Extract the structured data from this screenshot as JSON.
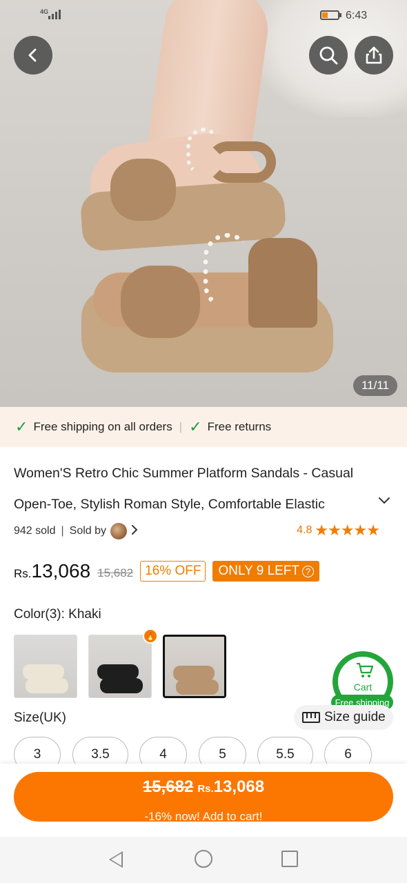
{
  "status_bar": {
    "network": "4G",
    "time": "6:43"
  },
  "hero": {
    "image_counter": "11/11"
  },
  "icons": {
    "back": "chevron-left-icon",
    "search": "search-icon",
    "share": "share-icon",
    "check": "check-icon",
    "cart": "cart-icon",
    "ruler": "ruler-icon"
  },
  "shipping_banner": {
    "item1": "Free shipping on all orders",
    "item2": "Free returns"
  },
  "product": {
    "title": "Women'S Retro Chic Summer Platform Sandals - Casual Open-Toe, Stylish Roman Style, Comfortable Elastic",
    "sold": "942 sold",
    "sold_by": "Sold by",
    "rating": "4.8",
    "stars": 5,
    "currency": "Rs.",
    "price": "13,068",
    "old_price": "15,682",
    "discount": "16% OFF",
    "stock": "ONLY 9 LEFT"
  },
  "color": {
    "label": "Color(3): Khaki",
    "selected_index": 2
  },
  "size": {
    "label": "Size(UK)",
    "guide": "Size guide",
    "options": [
      "3",
      "3.5",
      "4",
      "5",
      "5.5",
      "6"
    ]
  },
  "cart_fab": {
    "label": "Cart",
    "tag": "Free shipping"
  },
  "cta": {
    "old_price": "15,682",
    "currency": "Rs.",
    "price": "13,068",
    "subtitle": "-16% now! Add to cart!"
  },
  "colors": {
    "accent": "#fb7701",
    "discount": "#f07c00",
    "success": "#23a53a",
    "banner_bg": "#fcf1e8"
  }
}
